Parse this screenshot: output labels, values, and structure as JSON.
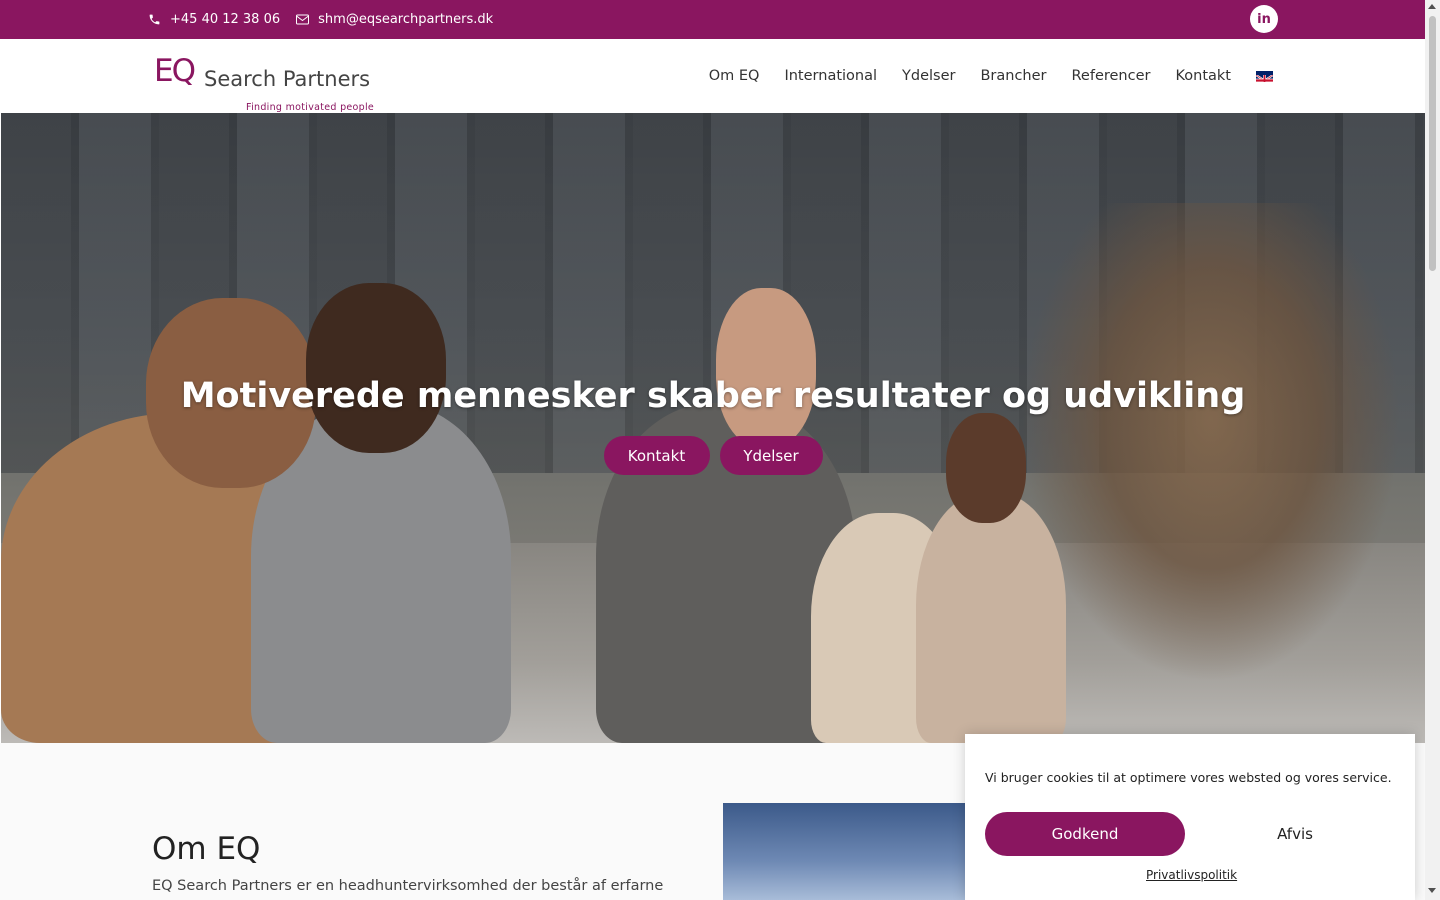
{
  "topbar": {
    "phone": "+45 40 12 38 06",
    "email": "shm@eqsearchpartners.dk",
    "social": "in"
  },
  "header": {
    "logo_mark": "EQ",
    "logo_name": "Search Partners",
    "logo_tagline": "Finding motivated people",
    "nav": [
      "Om EQ",
      "International",
      "Ydelser",
      "Brancher",
      "Referencer",
      "Kontakt"
    ],
    "language_icon": "uk-flag-icon"
  },
  "hero": {
    "title": "Motiverede mennesker skaber resultater og udvikling",
    "buttons": [
      "Kontakt",
      "Ydelser"
    ]
  },
  "about": {
    "title": "Om EQ",
    "text": "EQ Search Partners er en headhuntervirksomhed der består af erfarne"
  },
  "cookie": {
    "message": "Vi bruger cookies til at optimere vores websted og vores service.",
    "accept": "Godkend",
    "deny": "Afvis",
    "policy": "Privatlivspolitik"
  },
  "colors": {
    "brand": "#8a1660"
  }
}
